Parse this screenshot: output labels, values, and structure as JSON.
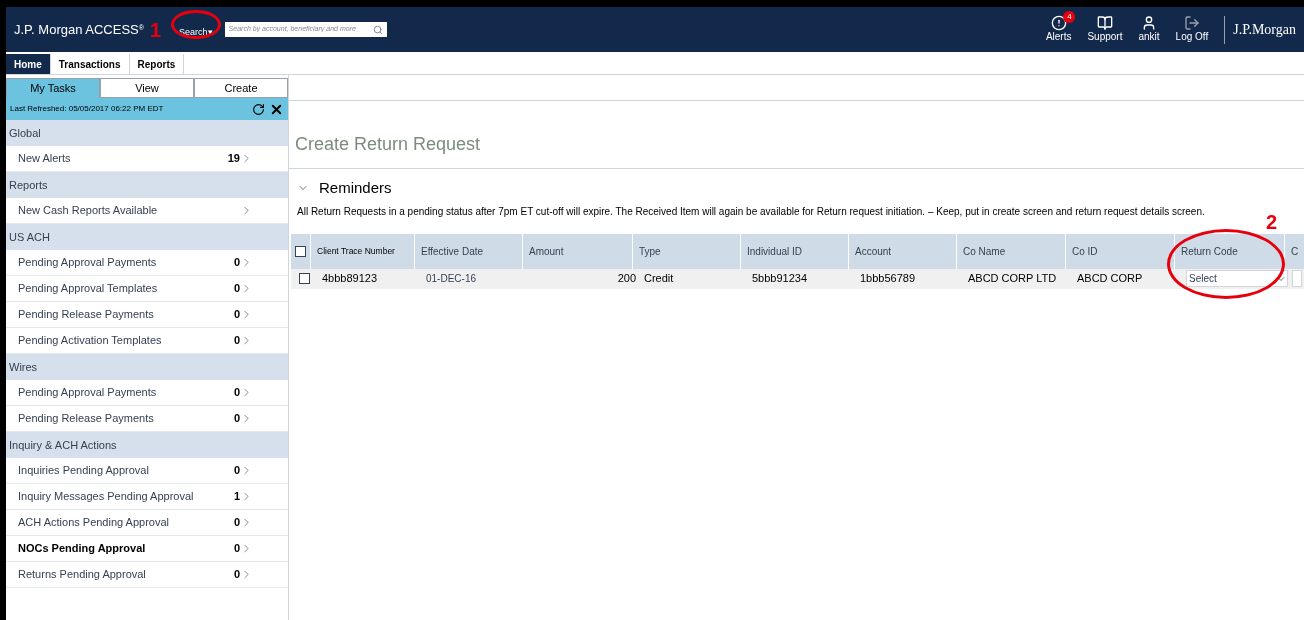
{
  "header": {
    "brand": "J.P. Morgan ACCESS",
    "brand_mark": "®",
    "search_menu": "Search▾",
    "search": {
      "placeholder": "Search by account, beneficiary and more"
    },
    "actions": [
      {
        "kind": "alert",
        "label": "Alerts",
        "badge": "4"
      },
      {
        "kind": "support",
        "label": "Support"
      },
      {
        "kind": "user",
        "label": "ankit"
      },
      {
        "kind": "logoff",
        "label": "Log Off"
      }
    ],
    "logo": "J.P.Morgan"
  },
  "tabs": [
    {
      "label": "Home",
      "selected": true
    },
    {
      "label": "Transactions",
      "selected": false
    },
    {
      "label": "Reports",
      "selected": false
    }
  ],
  "sidebar": {
    "tabs": [
      {
        "label": "My Tasks",
        "selected": true
      },
      {
        "label": "View",
        "selected": false
      },
      {
        "label": "Create",
        "selected": false
      }
    ],
    "refreshed": "Last Refreshed: 05/05/2017 06:22 PM EDT",
    "groups": [
      {
        "title": "Global",
        "items": [
          {
            "label": "New Alerts",
            "count": "19",
            "bold": false
          }
        ]
      },
      {
        "title": "Reports",
        "items": [
          {
            "label": "New Cash Reports Available",
            "bold": false
          }
        ]
      },
      {
        "title": "US ACH",
        "items": [
          {
            "label": "Pending Approval Payments",
            "count": "0",
            "bold": false
          },
          {
            "label": "Pending Approval Templates",
            "count": "0",
            "bold": false
          },
          {
            "label": "Pending Release Payments",
            "count": "0",
            "bold": false
          },
          {
            "label": "Pending Activation Templates",
            "count": "0",
            "bold": false
          }
        ]
      },
      {
        "title": "Wires",
        "items": [
          {
            "label": "Pending Approval Payments",
            "count": "0",
            "bold": false
          },
          {
            "label": "Pending Release Payments",
            "count": "0",
            "bold": false
          }
        ]
      },
      {
        "title": "Inquiry & ACH Actions",
        "items": [
          {
            "label": "Inquiries Pending Approval",
            "count": "0",
            "bold": false
          },
          {
            "label": "Inquiry Messages Pending Approval",
            "count": "1",
            "bold": false
          },
          {
            "label": "ACH Actions Pending Approval",
            "count": "0",
            "bold": false
          },
          {
            "label": "NOCs Pending Approval",
            "count": "0",
            "bold": true
          },
          {
            "label": "Returns Pending Approval",
            "count": "0",
            "bold": false
          }
        ]
      }
    ]
  },
  "page": {
    "title": "Create Return Request",
    "reminders": {
      "title": "Reminders",
      "expanded": true,
      "text": "All Return Requests in a pending status after 7pm ET cut-off will expire. The Received Item will again be available for Return request initiation. – Keep, put in create screen and return request details screen."
    }
  },
  "table": {
    "select_all": {
      "checked": false
    },
    "columns": [
      "Client Trace Number",
      "Effective Date",
      "Amount",
      "Type",
      "Individual ID",
      "Account",
      "Co Name",
      "Co ID",
      "Return Code",
      "C"
    ],
    "rows": [
      {
        "checked": false,
        "cells": [
          "4bbb89123",
          "01-DEC-16",
          "200",
          "Credit",
          "5bbb91234",
          "1bbb56789",
          "ABCD CORP LTD",
          "ABCD CORP"
        ],
        "return_code": "Select"
      }
    ]
  },
  "annotations": [
    {
      "label": "1"
    },
    {
      "label": "2"
    }
  ]
}
